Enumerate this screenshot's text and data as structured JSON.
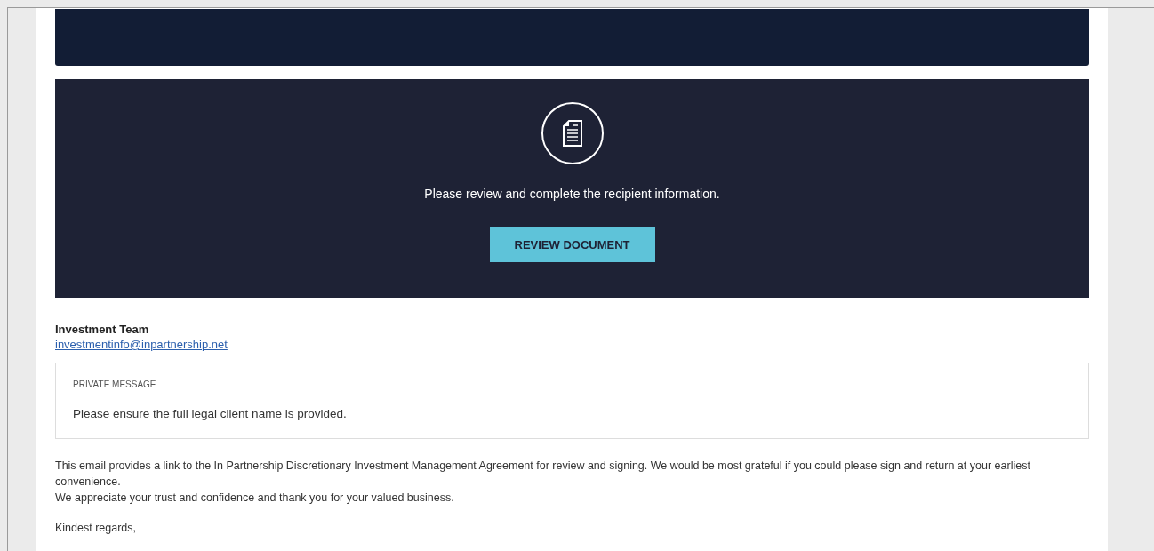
{
  "panel": {
    "message": "Please review and complete the recipient information.",
    "button": "REVIEW DOCUMENT"
  },
  "sender": {
    "name": "Investment Team",
    "email": "investmentinfo@inpartnership.net"
  },
  "private_message": {
    "heading": "PRIVATE MESSAGE",
    "text": "Please ensure the full legal client name is provided."
  },
  "body": [
    "This email provides a link to the In Partnership Discretionary Investment Management Agreement for review and signing. We would be most grateful if you could please sign and return at your earliest convenience.",
    "We appreciate your trust and confidence and thank you for your valued business."
  ],
  "closing": "Kindest regards,"
}
